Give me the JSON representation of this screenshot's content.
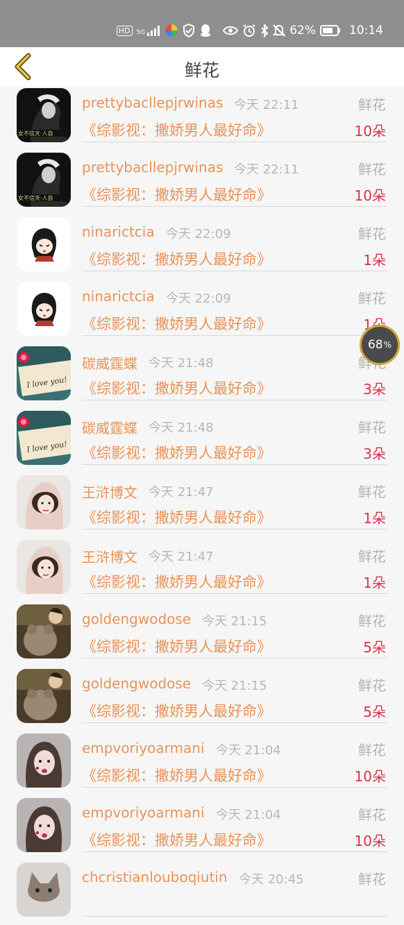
{
  "status_bar": {
    "hd": "HD",
    "network": "5G",
    "battery_percent": "62%",
    "time": "10:14"
  },
  "header": {
    "title": "鲜花"
  },
  "floating_ball": {
    "value": "68",
    "unit": "%"
  },
  "records": [
    {
      "name": "prettybacllepjrwinas",
      "time": "今天 22:11",
      "gift": "鲜花",
      "book": "《综影视：撒娇男人最好命》",
      "count": "10朵",
      "avatar": "dark-portrait"
    },
    {
      "name": "prettybacllepjrwinas",
      "time": "今天 22:11",
      "gift": "鲜花",
      "book": "《综影视：撒娇男人最好命》",
      "count": "10朵",
      "avatar": "dark-portrait"
    },
    {
      "name": "ninarictcia",
      "time": "今天 22:09",
      "gift": "鲜花",
      "book": "《综影视：撒娇男人最好命》",
      "count": "1朵",
      "avatar": "cartoon-girl"
    },
    {
      "name": "ninarictcia",
      "time": "今天 22:09",
      "gift": "鲜花",
      "book": "《综影视：撒娇男人最好命》",
      "count": "1朵",
      "avatar": "cartoon-girl"
    },
    {
      "name": "碳威霆蝶",
      "time": "今天 21:48",
      "gift": "鲜花",
      "book": "《综影视：撒娇男人最好命》",
      "count": "3朵",
      "avatar": "love-note"
    },
    {
      "name": "碳威霆蝶",
      "time": "今天 21:48",
      "gift": "鲜花",
      "book": "《综影视：撒娇男人最好命》",
      "count": "3朵",
      "avatar": "love-note"
    },
    {
      "name": "王浒博文",
      "time": "今天 21:47",
      "gift": "鲜花",
      "book": "《综影视：撒娇男人最好命》",
      "count": "1朵",
      "avatar": "girl-scarf"
    },
    {
      "name": "王浒博文",
      "time": "今天 21:47",
      "gift": "鲜花",
      "book": "《综影视：撒娇男人最好命》",
      "count": "1朵",
      "avatar": "girl-scarf"
    },
    {
      "name": "goldengwodose",
      "time": "今天 21:15",
      "gift": "鲜花",
      "book": "《综影视：撒娇男人最好命》",
      "count": "5朵",
      "avatar": "teddy-bear"
    },
    {
      "name": "goldengwodose",
      "time": "今天 21:15",
      "gift": "鲜花",
      "book": "《综影视：撒娇男人最好命》",
      "count": "5朵",
      "avatar": "teddy-bear"
    },
    {
      "name": "empvoriyoarmani",
      "time": "今天 21:04",
      "gift": "鲜花",
      "book": "《综影视：撒娇男人最好命》",
      "count": "10朵",
      "avatar": "girl-portrait"
    },
    {
      "name": "empvoriyoarmani",
      "time": "今天 21:04",
      "gift": "鲜花",
      "book": "《综影视：撒娇男人最好命》",
      "count": "10朵",
      "avatar": "girl-portrait"
    },
    {
      "name": "chcristianlouboqiutin",
      "time": "今天 20:45",
      "gift": "鲜花",
      "book": "",
      "count": "",
      "avatar": "cat"
    }
  ]
}
